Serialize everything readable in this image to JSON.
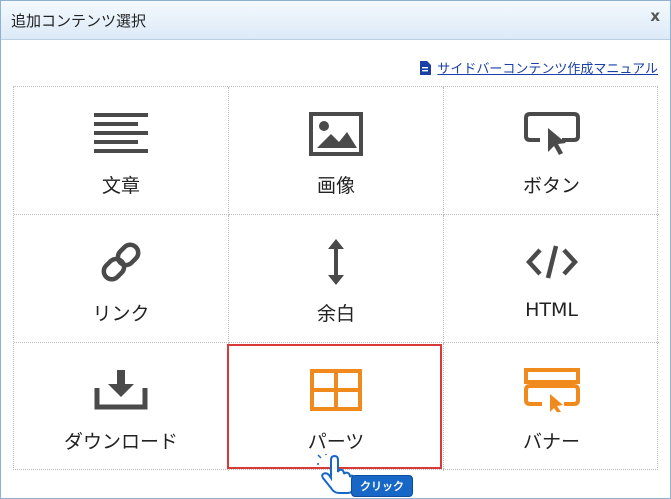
{
  "dialog": {
    "title": "追加コンテンツ選択",
    "close_label": "x"
  },
  "manual_link": "サイドバーコンテンツ作成マニュアル",
  "items": [
    {
      "label": "文章",
      "icon": "text-lines-icon"
    },
    {
      "label": "画像",
      "icon": "image-icon"
    },
    {
      "label": "ボタン",
      "icon": "button-cursor-icon"
    },
    {
      "label": "リンク",
      "icon": "link-icon"
    },
    {
      "label": "余白",
      "icon": "vertical-spacing-icon"
    },
    {
      "label": "HTML",
      "icon": "code-icon"
    },
    {
      "label": "ダウンロード",
      "icon": "download-icon"
    },
    {
      "label": "パーツ",
      "icon": "parts-grid-icon"
    },
    {
      "label": "バナー",
      "icon": "banner-icon"
    }
  ],
  "click_hint": "クリック",
  "colors": {
    "icon_gray": "#4a4a4a",
    "icon_orange": "#f08a1c",
    "highlight": "#d83a3a",
    "link": "#1a3fa8"
  }
}
